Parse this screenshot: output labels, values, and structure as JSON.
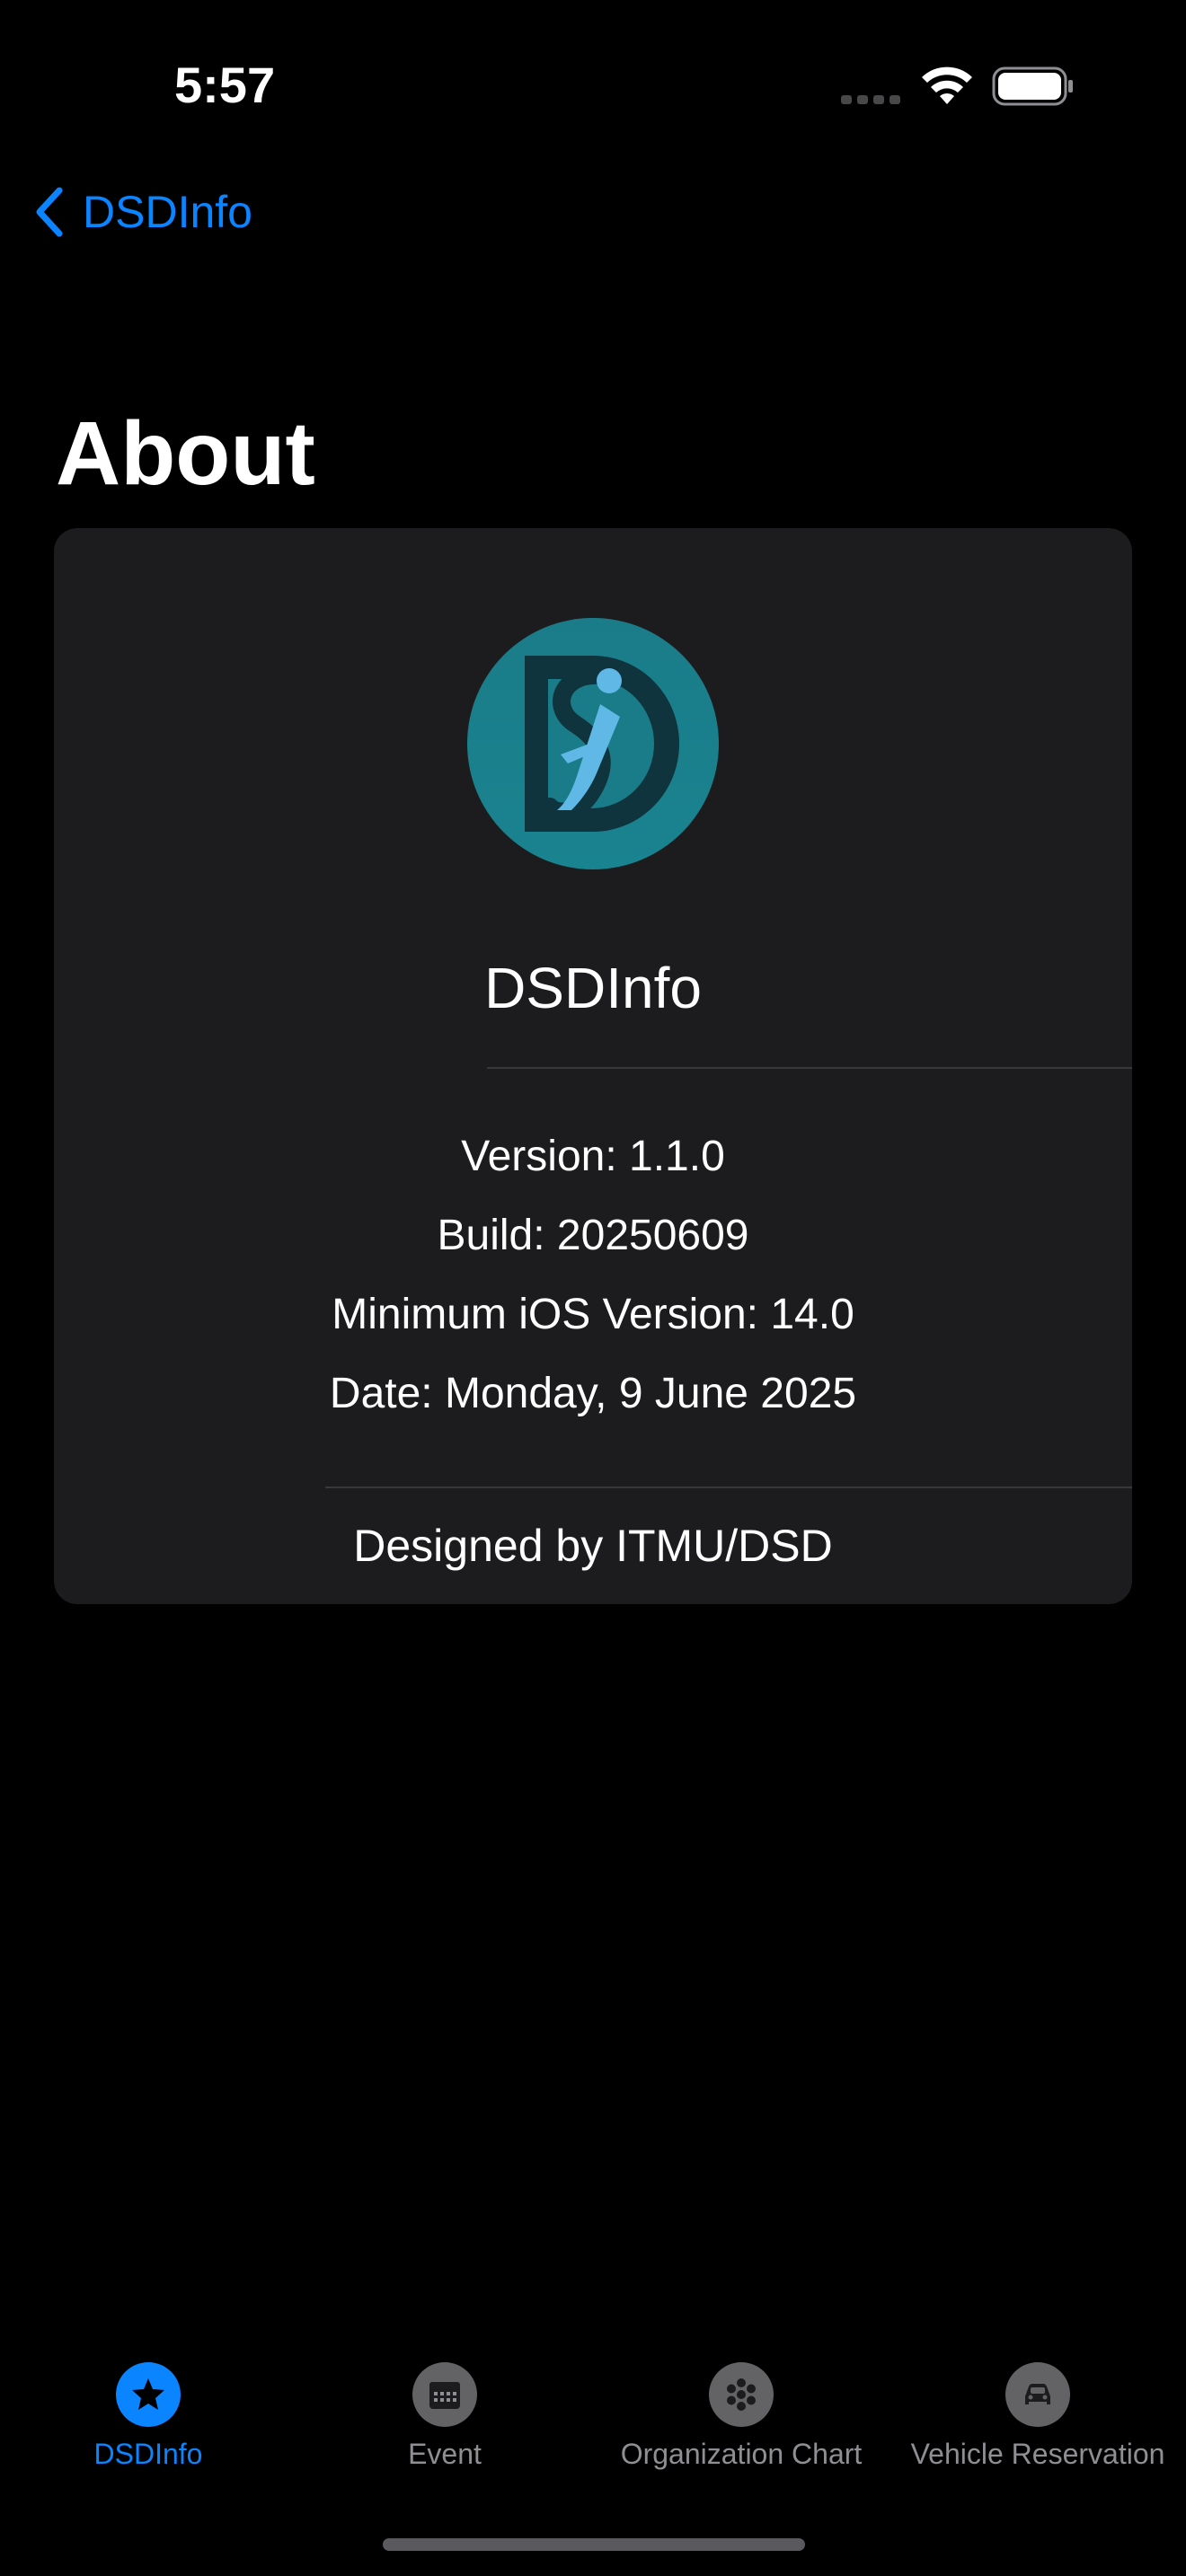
{
  "status_bar": {
    "time": "5:57"
  },
  "nav": {
    "back_label": "DSDInfo"
  },
  "page": {
    "title": "About"
  },
  "about": {
    "app_name": "DSDInfo",
    "version": "Version: 1.1.0",
    "build": "Build: 20250609",
    "minimum_ios": "Minimum iOS Version: 14.0",
    "date": "Date: Monday, 9 June 2025",
    "designed_by": "Designed by ITMU/DSD"
  },
  "tab_bar": {
    "items": [
      {
        "label": "DSDInfo",
        "icon": "star-icon",
        "active": true
      },
      {
        "label": "Event",
        "icon": "calendar-icon",
        "active": false
      },
      {
        "label": "Organization Chart",
        "icon": "dots-cluster-icon",
        "active": false
      },
      {
        "label": "Vehicle Reservation",
        "icon": "car-icon",
        "active": false
      }
    ]
  },
  "colors": {
    "accent": "#0a84ff",
    "background": "#000000",
    "card": "#1c1c1e",
    "logo_teal": "#1a7f8c",
    "inactive": "#8e8e93"
  }
}
